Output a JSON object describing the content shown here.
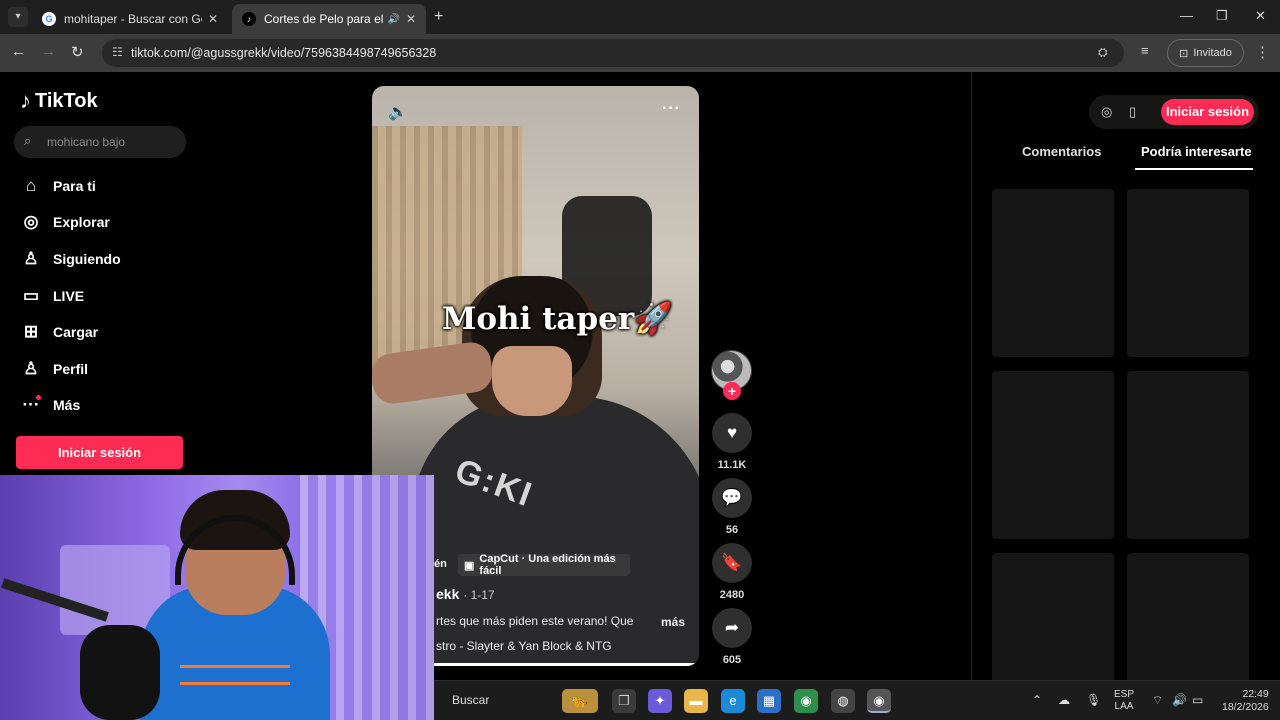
{
  "browser": {
    "tabs": [
      {
        "title": "mohitaper - Buscar con Google",
        "favicon": "google-icon"
      },
      {
        "title": "Cortes de Pelo para el Vera",
        "favicon": "tiktok-icon",
        "audio": true
      }
    ],
    "url": "tiktok.com/@agussgrekk/video/7596384498749656328",
    "profile_label": "Invitado"
  },
  "sidebar": {
    "logo": "TikTok",
    "search_placeholder": "mohicano bajo",
    "items": [
      {
        "label": "Para ti",
        "icon": "home-icon"
      },
      {
        "label": "Explorar",
        "icon": "compass-icon"
      },
      {
        "label": "Siguiendo",
        "icon": "following-icon"
      },
      {
        "label": "LIVE",
        "icon": "live-icon"
      },
      {
        "label": "Cargar",
        "icon": "upload-icon"
      },
      {
        "label": "Perfil",
        "icon": "profile-icon"
      },
      {
        "label": "Más",
        "icon": "more-icon"
      }
    ],
    "login_label": "Iniciar sesión"
  },
  "video": {
    "overlay_title": "Mohi taper🚀",
    "chip_prefix": "én",
    "chip_label": "CapCut · Una edición más fácil",
    "author": "ekk",
    "date": "· 1-17",
    "description": "rtes que más piden este verano! Que",
    "more_label": "más",
    "music": "stro - Slayter & Yan Block & NTG",
    "progress": 0.99
  },
  "actions": {
    "likes": "11.1K",
    "comments": "56",
    "saves": "2480",
    "shares": "605"
  },
  "right_panel": {
    "login_label": "Iniciar sesión",
    "tabs": [
      "Comentarios",
      "Podría interesarte"
    ],
    "active_tab": "Podría interesarte"
  },
  "taskbar": {
    "search_label": "Buscar",
    "language": "ESP",
    "language_sub": "LAA",
    "time": "22:49",
    "date": "18/2/2026"
  },
  "colors": {
    "accent": "#fe2c55",
    "chrome_bg": "#1f1f1f",
    "page_bg": "#000000"
  }
}
